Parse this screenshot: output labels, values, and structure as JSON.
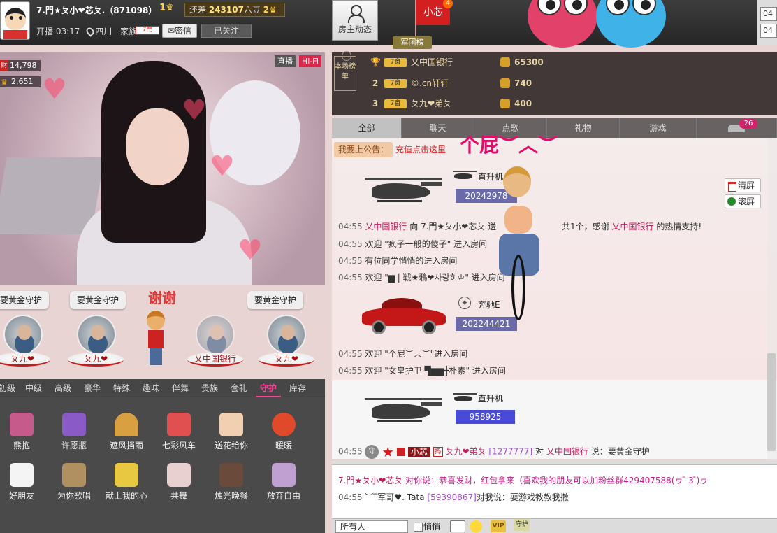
{
  "header": {
    "anchor_name": "7.門★ㄆ小❤芯ㄆ.（871098）",
    "level_num": "1",
    "gap_prefix": "还差",
    "gap_value": "243107",
    "gap_suffix": "六豆",
    "gap_level": "2",
    "start_label": "开播 03:17",
    "location": "四川",
    "family_label": "家族",
    "family_badge": "7門",
    "msg_button": "密信",
    "follow_button": "已关注",
    "host_button": "房主动态",
    "flag_name": "小芯",
    "flag_count": "4",
    "legion_button": "军团榜",
    "top_right_1": "04",
    "top_right_2": "04"
  },
  "video": {
    "live_tag": "直播",
    "hifi_tag": "Hi-Fi",
    "stat_wealth_icon": "财",
    "stat_wealth": "14,798",
    "stat_fans": "2,651"
  },
  "guards": {
    "thanks_text": "谢谢",
    "items": [
      {
        "bubble": "要黄金守护",
        "plate": "ㄆ九❤"
      },
      {
        "bubble": "要黄金守护",
        "plate": "ㄆ九❤"
      },
      {
        "bubble": "",
        "plate": ""
      },
      {
        "bubble": "",
        "plate": "乂中国银行"
      },
      {
        "bubble": "要黄金守护",
        "plate": "ㄆ九❤"
      }
    ]
  },
  "gift_categories": [
    "初级",
    "中级",
    "高级",
    "豪华",
    "特殊",
    "趣味",
    "伴舞",
    "贵族",
    "套礼",
    "守护",
    "库存"
  ],
  "gift_active": "守护",
  "gifts": [
    {
      "label": "熊抱",
      "color": "#c65a8a"
    },
    {
      "label": "许愿瓶",
      "color": "#8a5ac6"
    },
    {
      "label": "遮风挡雨",
      "color": "#d8a040"
    },
    {
      "label": "七彩风车",
      "color": "#e05050"
    },
    {
      "label": "送花给你",
      "color": "#f0d0b0"
    },
    {
      "label": "暖暖",
      "color": "#e04a2a"
    },
    {
      "label": "好朋友",
      "color": "#f4f4f4"
    },
    {
      "label": "为你歌唱",
      "color": "#b09060"
    },
    {
      "label": "献上我的心",
      "color": "#e8c840"
    },
    {
      "label": "共舞",
      "color": "#e8d0d0"
    },
    {
      "label": "烛光晚餐",
      "color": "#6a4a3a"
    },
    {
      "label": "放弃自由",
      "color": "#c0a0d0"
    }
  ],
  "rank": {
    "label": "本场榜单",
    "rows": [
      {
        "rank": "1",
        "badge": "7窗",
        "name": "乂中国银行",
        "value": "65300"
      },
      {
        "rank": "2",
        "badge": "7窗",
        "name": "©.cn轩轩",
        "value": "740"
      },
      {
        "rank": "3",
        "badge": "7窗",
        "name": "ㄆ九❤弟ㄆ",
        "value": "400"
      }
    ]
  },
  "tabs": [
    "全部",
    "聊天",
    "点歌",
    "礼物",
    "游戏",
    ""
  ],
  "tab_active": "全部",
  "tab_badge": "26",
  "notice": {
    "label": "我要上公告",
    "colon": "：",
    "link": "充值点击这里"
  },
  "floating_text": "个屁︶︿︶",
  "chat": {
    "gift1_name": "直升机",
    "gift1_num": "20242978",
    "gift2_name": "奔驰E",
    "gift2_num": "202244421",
    "gift3_name": "直升机",
    "gift3_num": "958925",
    "clear_btn": "清屏",
    "scroll_btn": "滚屏",
    "lines": [
      {
        "time": "04:55",
        "user": "乂中国银行",
        "mid": "向 7.門★ㄆ小❤芯ㄆ 送",
        "tail": "共1个，感谢",
        "user2": "乂中国银行",
        "end": "的热情支持!"
      },
      {
        "time": "04:55",
        "text": "欢迎 \"疯子一般的傻子\" 进入房间"
      },
      {
        "time": "04:55",
        "text": "有位同学悄悄的进入房间"
      },
      {
        "time": "04:55",
        "text": "欢迎 \"▆ | 戦★鴉❤사랑히♔\" 进入房间"
      },
      {
        "time": "04:55",
        "text": "欢迎 \"个屁︶︿︶\"进入房间"
      },
      {
        "time": "04:55",
        "text": "欢迎 \"女皇护卫 ▜▆▆╋朴素\" 进入房间"
      }
    ],
    "final_line": {
      "time": "04:55",
      "badge": "小芯",
      "rank_icon": "捣",
      "user": "ㄆ九❤弟ㄆ",
      "uid": "[1277777]",
      "mid": "对",
      "target": "乂中国银行",
      "say": "说：要黄金守护"
    }
  },
  "private": {
    "line1_user": "7.門★ㄆ小❤芯ㄆ",
    "line1_text": "对你说：恭喜发财，红包拿来（喜欢我的朋友可以加粉丝群429407588(ヮ ̄ 3 ̄)ヮ",
    "line2_time": "04:55",
    "line2_user": "︶‾军哥♥. Tata",
    "line2_uid": "[59390867]",
    "line2_text": "对我说：耍游戏教教我撒"
  },
  "bottom": {
    "audience": "所有人",
    "secret": "悄悄",
    "vip": "VIP",
    "guard": "守护"
  }
}
